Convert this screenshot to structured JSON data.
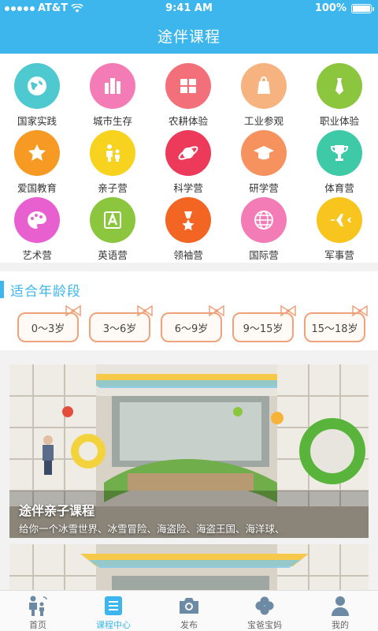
{
  "status_bar": {
    "carrier": "AT&T",
    "time": "9:41 AM",
    "battery": "100%"
  },
  "nav": {
    "title": "途伴课程"
  },
  "categories": [
    {
      "label": "国家实践",
      "icon": "globe-icon",
      "color": "#4fc9d0"
    },
    {
      "label": "城市生存",
      "icon": "city-icon",
      "color": "#f47cb6"
    },
    {
      "label": "农耕体验",
      "icon": "field-icon",
      "color": "#f3707a"
    },
    {
      "label": "工业参观",
      "icon": "bag-icon",
      "color": "#f6b37f"
    },
    {
      "label": "职业体验",
      "icon": "tie-icon",
      "color": "#8cc63f"
    },
    {
      "label": "爱国教育",
      "icon": "star-icon",
      "color": "#f79a23"
    },
    {
      "label": "亲子营",
      "icon": "family-icon",
      "color": "#f7d21e"
    },
    {
      "label": "科学营",
      "icon": "planet-icon",
      "color": "#ee3a5a"
    },
    {
      "label": "研学营",
      "icon": "graduation-cap-icon",
      "color": "#f6925e"
    },
    {
      "label": "体育营",
      "icon": "trophy-icon",
      "color": "#3ec9a7"
    },
    {
      "label": "艺术营",
      "icon": "palette-icon",
      "color": "#e85fd0"
    },
    {
      "label": "英语营",
      "icon": "letter-a-icon",
      "color": "#8cc63f"
    },
    {
      "label": "领袖营",
      "icon": "medal-icon",
      "color": "#f26522"
    },
    {
      "label": "国际营",
      "icon": "world-icon",
      "color": "#f47cb6"
    },
    {
      "label": "军事营",
      "icon": "plane-icon",
      "color": "#f7c51e"
    }
  ],
  "age_section": {
    "title": "适合年龄段",
    "ranges": [
      "0～3岁",
      "3～6岁",
      "6～9岁",
      "9～15岁",
      "15～18岁"
    ]
  },
  "courses": [
    {
      "title": "途伴亲子课程",
      "description": "给你一个冰雪世界、冰雪冒险、海盗险、海盗王国、海洋球、"
    }
  ],
  "tabs": [
    {
      "label": "首页",
      "icon": "home-family-icon",
      "active": false
    },
    {
      "label": "课程中心",
      "icon": "course-book-icon",
      "active": true
    },
    {
      "label": "发布",
      "icon": "camera-icon",
      "active": false
    },
    {
      "label": "宝爸宝妈",
      "icon": "clover-icon",
      "active": false
    },
    {
      "label": "我的",
      "icon": "user-icon",
      "active": false
    }
  ],
  "colors": {
    "accent": "#3db6ee",
    "tag_border": "#f0a27a"
  }
}
